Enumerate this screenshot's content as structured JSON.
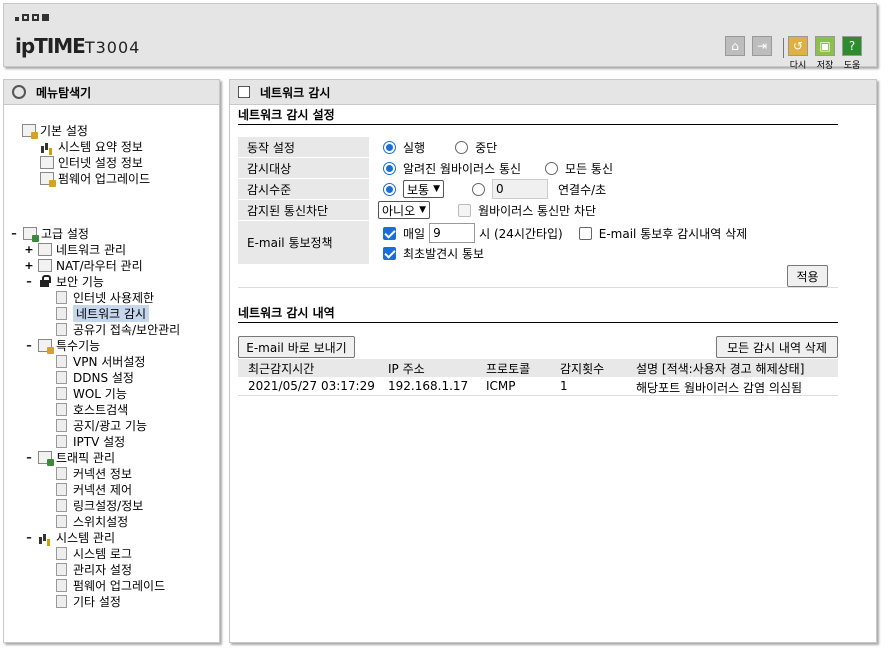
{
  "header": {
    "logo": "ipTIME",
    "model": "T3004",
    "buttons": {
      "refresh_label": "다시",
      "save_label": "저장",
      "help_label": "도움"
    }
  },
  "left_panel": {
    "title": "메뉴탐색기",
    "basic": {
      "label": "기본 설정",
      "items": [
        "시스템 요약 정보",
        "인터넷 설정 정보",
        "펌웨어 업그레이드"
      ]
    },
    "advanced": {
      "label": "고급 설정",
      "network": "네트워크 관리",
      "nat": "NAT/라우터 관리",
      "security": {
        "label": "보안 기능",
        "items": [
          "인터넷 사용제한",
          "네트워크 감시",
          "공유기 접속/보안관리"
        ]
      },
      "special": {
        "label": "특수기능",
        "items": [
          "VPN 서버설정",
          "DDNS 설정",
          "WOL 기능",
          "호스트검색",
          "공지/광고 기능",
          "IPTV 설정"
        ]
      },
      "traffic": {
        "label": "트래픽 관리",
        "items": [
          "커넥션 정보",
          "커넥션 제어",
          "링크설정/정보",
          "스위치설정"
        ]
      },
      "system": {
        "label": "시스템 관리",
        "items": [
          "시스템 로그",
          "관리자 설정",
          "펌웨어 업그레이드",
          "기타 설정"
        ]
      }
    }
  },
  "right_panel": {
    "title": "네트워크 감시",
    "settings": {
      "section_title": "네트워크 감시 설정",
      "operation": {
        "label": "동작 설정",
        "run": "실행",
        "stop": "중단",
        "selected": "run"
      },
      "target": {
        "label": "감시대상",
        "known": "알려진 웜바이러스 통신",
        "all": "모든 통신",
        "selected": "known"
      },
      "level": {
        "label": "감시수준",
        "preset": "보통",
        "custom_value": "0",
        "unit": "연결수/초",
        "selected": "preset"
      },
      "block": {
        "label": "감지된 통신차단",
        "value": "아니오",
        "worm_only": "웜바이러스 통신만 차단",
        "worm_only_checked": false
      },
      "email": {
        "label": "E-mail 통보정책",
        "daily": "매일",
        "daily_checked": true,
        "hour": "9",
        "hour_unit": "시 (24시간타입)",
        "delete_after": "E-mail 통보후 감시내역 삭제",
        "delete_after_checked": false,
        "first_detect": "최초발견시 통보",
        "first_detect_checked": true
      },
      "apply_label": "적용"
    },
    "history": {
      "section_title": "네트워크 감시 내역",
      "email_now_label": "E-mail 바로 보내기",
      "delete_all_label": "모든 감시 내역 삭제",
      "columns": [
        "최근감지시간",
        "IP 주소",
        "프로토콜",
        "감지횟수",
        "설명 [적색:사용자 경고 해제상태]"
      ],
      "rows": [
        [
          "2021/05/27 03:17:29",
          "192.168.1.17",
          "ICMP",
          "1",
          "해당포트 웜바이러스 감염 의심됨"
        ]
      ]
    }
  },
  "colors": {
    "panel_bg": "#e5e5e5",
    "selected_item": "#c6d6ec",
    "accent": "#1a6ed8",
    "refresh": "#e0b040",
    "save": "#8cc04a",
    "help": "#2e8b2e"
  }
}
